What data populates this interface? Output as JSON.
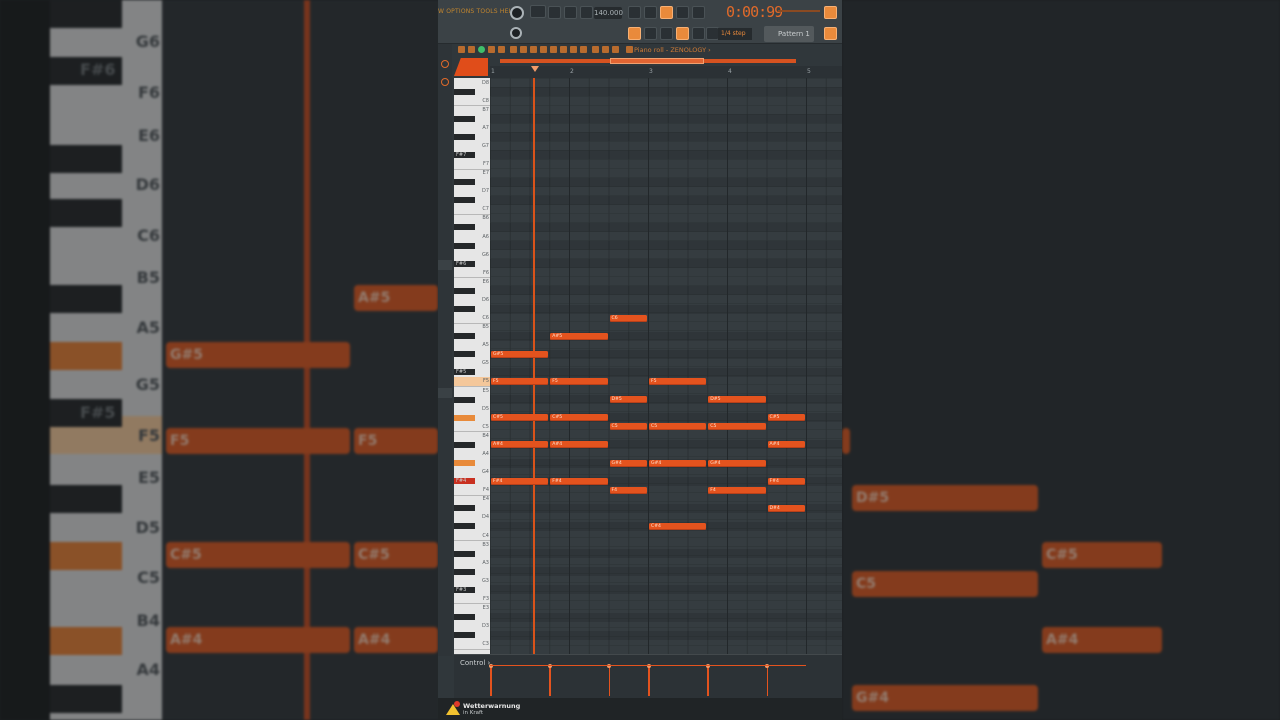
{
  "menu": {
    "text": "W OPTIONS TOOLS HELP"
  },
  "transport": {
    "tempo": "140.000",
    "time": "0:00:99",
    "snap": "1/4 step",
    "pattern": "Pattern 1"
  },
  "piano_roll": {
    "title": "Piano roll - ZENOLOGY ›"
  },
  "ruler": {
    "bars": [
      "1",
      "2",
      "3",
      "4",
      "5"
    ]
  },
  "keys": {
    "white_labels": [
      "D8",
      "C8",
      "B7",
      "A7",
      "G7",
      "F7",
      "E7",
      "D7",
      "C7",
      "B6",
      "A6",
      "G6",
      "F6",
      "E6",
      "D6",
      "C6",
      "B5",
      "A5",
      "G5",
      "F5",
      "E5",
      "D5",
      "C5",
      "B4",
      "A4",
      "G4",
      "F4",
      "E4",
      "D4",
      "C4",
      "B3",
      "A3",
      "G3",
      "F3",
      "E3",
      "D3",
      "C3"
    ],
    "black_labels": [
      "F#7",
      "F#6",
      "F#5",
      "F#4",
      "F#3"
    ]
  },
  "notes": [
    {
      "label": "C6"
    },
    {
      "label": "A#5"
    },
    {
      "label": "G#5"
    },
    {
      "label": "F5"
    },
    {
      "label": "F5"
    },
    {
      "label": "F5"
    },
    {
      "label": "D#5"
    },
    {
      "label": "D#5"
    },
    {
      "label": "C#5"
    },
    {
      "label": "C#5"
    },
    {
      "label": "C5"
    },
    {
      "label": "C5"
    },
    {
      "label": "C5"
    },
    {
      "label": "C#5"
    },
    {
      "label": "A#4"
    },
    {
      "label": "A#4"
    },
    {
      "label": "A#4"
    },
    {
      "label": "G#4"
    },
    {
      "label": "G#4"
    },
    {
      "label": "G#4"
    },
    {
      "label": "F#4"
    },
    {
      "label": "F#4"
    },
    {
      "label": "F4"
    },
    {
      "label": "F4"
    },
    {
      "label": "F#4"
    },
    {
      "label": "D#4"
    },
    {
      "label": "C#4"
    }
  ],
  "control": {
    "label": "Control ›"
  },
  "notification": {
    "title": "Wetterwarnung",
    "subtitle": "in Kraft"
  },
  "background": {
    "key_labels": [
      "G6",
      "F6",
      "E6",
      "D6",
      "C6",
      "B5",
      "A5",
      "G5",
      "F5",
      "E5",
      "D5",
      "C5",
      "B4",
      "A4"
    ],
    "black_labels": [
      "F#6",
      "F#5"
    ],
    "notes_left": [
      "G#5",
      "A#5",
      "F5",
      "F5",
      "C#5",
      "C#5",
      "A#4",
      "A#4"
    ],
    "notes_right": [
      "D#5",
      "C#5",
      "C5",
      "A#4",
      "G#4"
    ]
  },
  "colors": {
    "accent": "#e4531e",
    "panel": "#30373b",
    "timer": "#e06a2a"
  }
}
